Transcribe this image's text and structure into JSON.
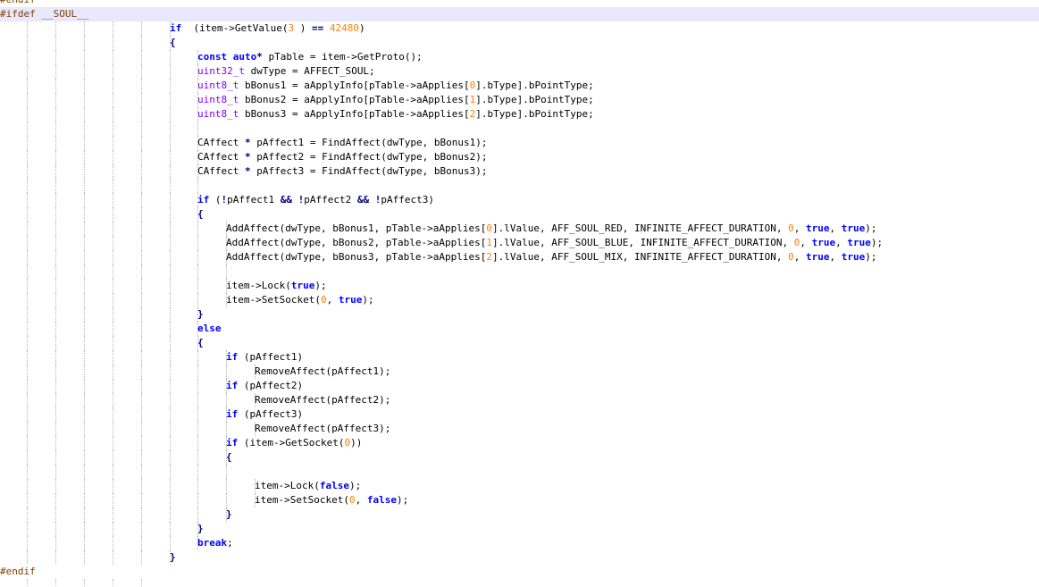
{
  "editor": {
    "current_line_index": 1,
    "lines": [
      {
        "indent": 0,
        "tokens": [
          [
            "pp",
            "#endif"
          ]
        ]
      },
      {
        "indent": 0,
        "tokens": [
          [
            "pp",
            "#ifdef __SOUL__"
          ]
        ]
      },
      {
        "indent": 6,
        "tokens": [
          [
            "kw",
            "if"
          ],
          [
            "",
            "  (item->GetValue("
          ],
          [
            "num",
            "3"
          ],
          [
            "",
            " ) "
          ],
          [
            "op",
            "=="
          ],
          [
            "",
            " "
          ],
          [
            "num",
            "42480"
          ],
          [
            "",
            ")"
          ]
        ]
      },
      {
        "indent": 6,
        "tokens": [
          [
            "op",
            "{"
          ]
        ]
      },
      {
        "indent": 7,
        "tokens": [
          [
            "kw",
            "const"
          ],
          [
            "",
            " "
          ],
          [
            "kw",
            "auto"
          ],
          [
            "op",
            "*"
          ],
          [
            "",
            " pTable = item->GetProto();"
          ]
        ]
      },
      {
        "indent": 7,
        "tokens": [
          [
            "ty",
            "uint32_t"
          ],
          [
            "",
            " dwType = AFFECT_SOUL;"
          ]
        ]
      },
      {
        "indent": 7,
        "tokens": [
          [
            "ty",
            "uint8_t"
          ],
          [
            "",
            " bBonus1 = aApplyInfo[pTable->aApplies["
          ],
          [
            "num",
            "0"
          ],
          [
            "",
            "].bType].bPointType;"
          ]
        ]
      },
      {
        "indent": 7,
        "tokens": [
          [
            "ty",
            "uint8_t"
          ],
          [
            "",
            " bBonus2 = aApplyInfo[pTable->aApplies["
          ],
          [
            "num",
            "1"
          ],
          [
            "",
            "].bType].bPointType;"
          ]
        ]
      },
      {
        "indent": 7,
        "tokens": [
          [
            "ty",
            "uint8_t"
          ],
          [
            "",
            " bBonus3 = aApplyInfo[pTable->aApplies["
          ],
          [
            "num",
            "2"
          ],
          [
            "",
            "].bType].bPointType;"
          ]
        ]
      },
      {
        "indent": -1,
        "tokens": []
      },
      {
        "indent": 7,
        "tokens": [
          [
            "",
            "CAffect "
          ],
          [
            "op",
            "*"
          ],
          [
            "",
            " pAffect1 = FindAffect(dwType, bBonus1);"
          ]
        ]
      },
      {
        "indent": 7,
        "tokens": [
          [
            "",
            "CAffect "
          ],
          [
            "op",
            "*"
          ],
          [
            "",
            " pAffect2 = FindAffect(dwType, bBonus2);"
          ]
        ]
      },
      {
        "indent": 7,
        "tokens": [
          [
            "",
            "CAffect "
          ],
          [
            "op",
            "*"
          ],
          [
            "",
            " pAffect3 = FindAffect(dwType, bBonus3);"
          ]
        ]
      },
      {
        "indent": -1,
        "tokens": []
      },
      {
        "indent": 7,
        "tokens": [
          [
            "kw",
            "if"
          ],
          [
            "",
            " ("
          ],
          [
            "op",
            "!"
          ],
          [
            "",
            "pAffect1 "
          ],
          [
            "op",
            "&&"
          ],
          [
            "",
            " "
          ],
          [
            "op",
            "!"
          ],
          [
            "",
            "pAffect2 "
          ],
          [
            "op",
            "&&"
          ],
          [
            "",
            " "
          ],
          [
            "op",
            "!"
          ],
          [
            "",
            "pAffect3)"
          ]
        ]
      },
      {
        "indent": 7,
        "tokens": [
          [
            "op",
            "{"
          ]
        ]
      },
      {
        "indent": 8,
        "tokens": [
          [
            "",
            "AddAffect(dwType, bBonus1, pTable->aApplies["
          ],
          [
            "num",
            "0"
          ],
          [
            "",
            "].lValue, AFF_SOUL_RED, INFINITE_AFFECT_DURATION, "
          ],
          [
            "num",
            "0"
          ],
          [
            "",
            ", "
          ],
          [
            "kw",
            "true"
          ],
          [
            "",
            ", "
          ],
          [
            "kw",
            "true"
          ],
          [
            "",
            ");"
          ]
        ]
      },
      {
        "indent": 8,
        "tokens": [
          [
            "",
            "AddAffect(dwType, bBonus2, pTable->aApplies["
          ],
          [
            "num",
            "1"
          ],
          [
            "",
            "].lValue, AFF_SOUL_BLUE, INFINITE_AFFECT_DURATION, "
          ],
          [
            "num",
            "0"
          ],
          [
            "",
            ", "
          ],
          [
            "kw",
            "true"
          ],
          [
            "",
            ", "
          ],
          [
            "kw",
            "true"
          ],
          [
            "",
            ");"
          ]
        ]
      },
      {
        "indent": 8,
        "tokens": [
          [
            "",
            "AddAffect(dwType, bBonus3, pTable->aApplies["
          ],
          [
            "num",
            "2"
          ],
          [
            "",
            "].lValue, AFF_SOUL_MIX, INFINITE_AFFECT_DURATION, "
          ],
          [
            "num",
            "0"
          ],
          [
            "",
            ", "
          ],
          [
            "kw",
            "true"
          ],
          [
            "",
            ", "
          ],
          [
            "kw",
            "true"
          ],
          [
            "",
            ");"
          ]
        ]
      },
      {
        "indent": -1,
        "tokens": []
      },
      {
        "indent": 8,
        "tokens": [
          [
            "",
            "item->Lock("
          ],
          [
            "kw",
            "true"
          ],
          [
            "",
            ");"
          ]
        ]
      },
      {
        "indent": 8,
        "tokens": [
          [
            "",
            "item->SetSocket("
          ],
          [
            "num",
            "0"
          ],
          [
            "",
            ", "
          ],
          [
            "kw",
            "true"
          ],
          [
            "",
            ");"
          ]
        ]
      },
      {
        "indent": 7,
        "tokens": [
          [
            "op",
            "}"
          ]
        ]
      },
      {
        "indent": 7,
        "tokens": [
          [
            "kw",
            "else"
          ]
        ]
      },
      {
        "indent": 7,
        "tokens": [
          [
            "op",
            "{"
          ]
        ]
      },
      {
        "indent": 8,
        "tokens": [
          [
            "kw",
            "if"
          ],
          [
            "",
            " (pAffect1)"
          ]
        ]
      },
      {
        "indent": 9,
        "tokens": [
          [
            "",
            "RemoveAffect(pAffect1);"
          ]
        ]
      },
      {
        "indent": 8,
        "tokens": [
          [
            "kw",
            "if"
          ],
          [
            "",
            " (pAffect2)"
          ]
        ]
      },
      {
        "indent": 9,
        "tokens": [
          [
            "",
            "RemoveAffect(pAffect2);"
          ]
        ]
      },
      {
        "indent": 8,
        "tokens": [
          [
            "kw",
            "if"
          ],
          [
            "",
            " (pAffect3)"
          ]
        ]
      },
      {
        "indent": 9,
        "tokens": [
          [
            "",
            "RemoveAffect(pAffect3);"
          ]
        ]
      },
      {
        "indent": 8,
        "tokens": [
          [
            "kw",
            "if"
          ],
          [
            "",
            " (item->GetSocket("
          ],
          [
            "num",
            "0"
          ],
          [
            "",
            "))"
          ]
        ]
      },
      {
        "indent": 8,
        "tokens": [
          [
            "op",
            "{"
          ]
        ]
      },
      {
        "indent": -1,
        "tokens": []
      },
      {
        "indent": 9,
        "tokens": [
          [
            "",
            "item->Lock("
          ],
          [
            "kw",
            "false"
          ],
          [
            "",
            ");"
          ]
        ]
      },
      {
        "indent": 9,
        "tokens": [
          [
            "",
            "item->SetSocket("
          ],
          [
            "num",
            "0"
          ],
          [
            "",
            ", "
          ],
          [
            "kw",
            "false"
          ],
          [
            "",
            ");"
          ]
        ]
      },
      {
        "indent": 8,
        "tokens": [
          [
            "op",
            "}"
          ]
        ]
      },
      {
        "indent": 7,
        "tokens": [
          [
            "op",
            "}"
          ]
        ]
      },
      {
        "indent": 7,
        "tokens": [
          [
            "kw",
            "break"
          ],
          [
            "",
            ";"
          ]
        ]
      },
      {
        "indent": 6,
        "tokens": [
          [
            "op",
            "}"
          ]
        ]
      },
      {
        "indent": 0,
        "tokens": [
          [
            "pp",
            "#endif"
          ]
        ]
      },
      {
        "indent": -1,
        "tokens": []
      }
    ]
  }
}
